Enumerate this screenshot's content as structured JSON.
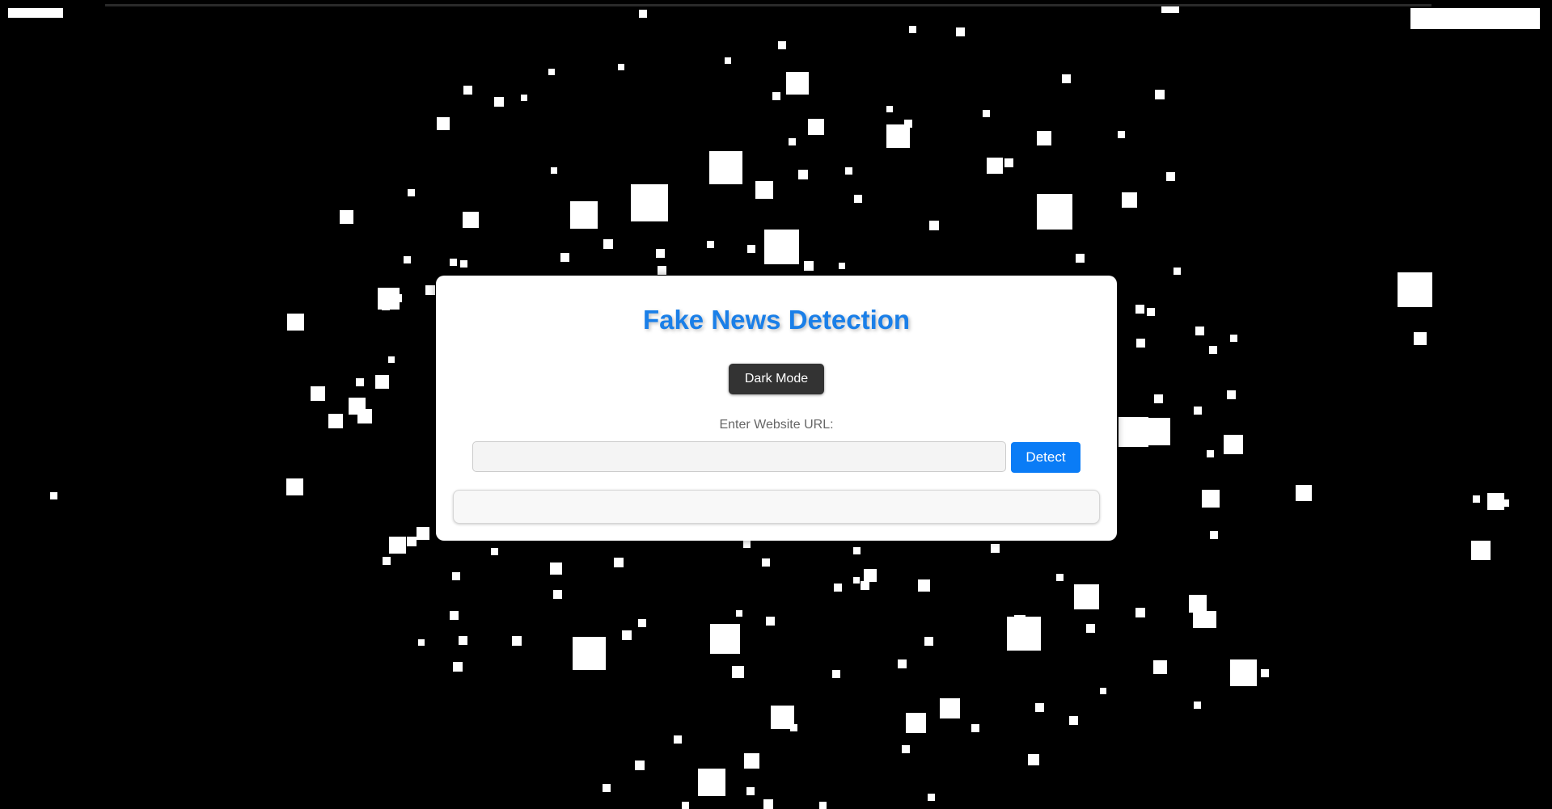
{
  "app": {
    "title": "Fake News Detection"
  },
  "controls": {
    "dark_mode_label": "Dark Mode",
    "url_label": "Enter Website URL:",
    "url_value": "",
    "url_placeholder": "",
    "detect_label": "Detect"
  },
  "result": {
    "text": ""
  },
  "colors": {
    "background": "#000000",
    "particle": "#ffffff",
    "card": "#ffffff",
    "title": "#1a7fe8",
    "dark_button": "#333333",
    "detect_button": "#0a7cf6",
    "label": "#666666"
  },
  "icons": {
    "background_effect": "falling-square-particles"
  }
}
